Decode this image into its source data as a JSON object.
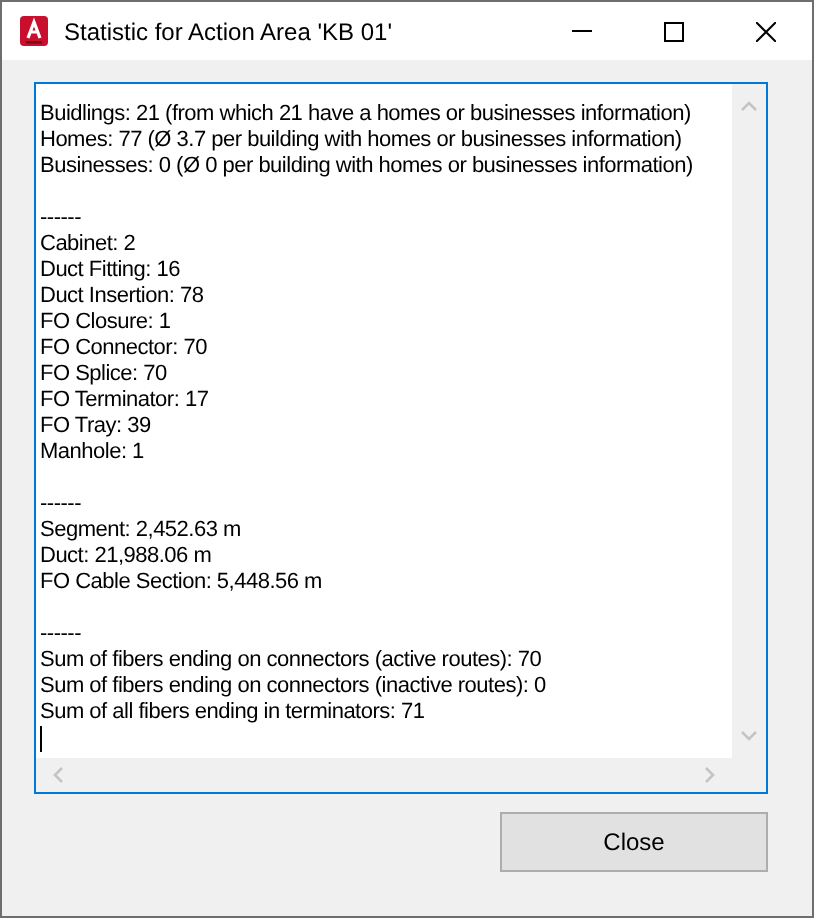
{
  "window": {
    "title": "Statistic for Action Area 'KB 01'"
  },
  "text_box": {
    "sections": [
      {
        "lines": [
          "Buidlings: 21 (from which 21 have a homes or businesses information)",
          "Homes: 77 (Ø 3.7 per building with homes or businesses information)",
          "Businesses: 0 (Ø 0 per building with homes or businesses information)"
        ]
      },
      {
        "lines": [
          "------",
          "Cabinet: 2",
          "Duct Fitting: 16",
          "Duct Insertion: 78",
          "FO Closure: 1",
          "FO Connector: 70",
          "FO Splice: 70",
          "FO Terminator: 17",
          "FO Tray: 39",
          "Manhole: 1"
        ]
      },
      {
        "lines": [
          "------",
          "Segment: 2,452.63 m",
          "Duct: 21,988.06 m",
          "FO Cable Section: 5,448.56 m"
        ]
      },
      {
        "lines": [
          "------",
          "Sum of fibers ending on connectors (active routes): 70",
          "Sum of fibers ending on connectors (inactive routes): 0",
          "Sum of all fibers ending in terminators: 71"
        ]
      }
    ]
  },
  "buttons": [
    {
      "label": "Close"
    }
  ]
}
